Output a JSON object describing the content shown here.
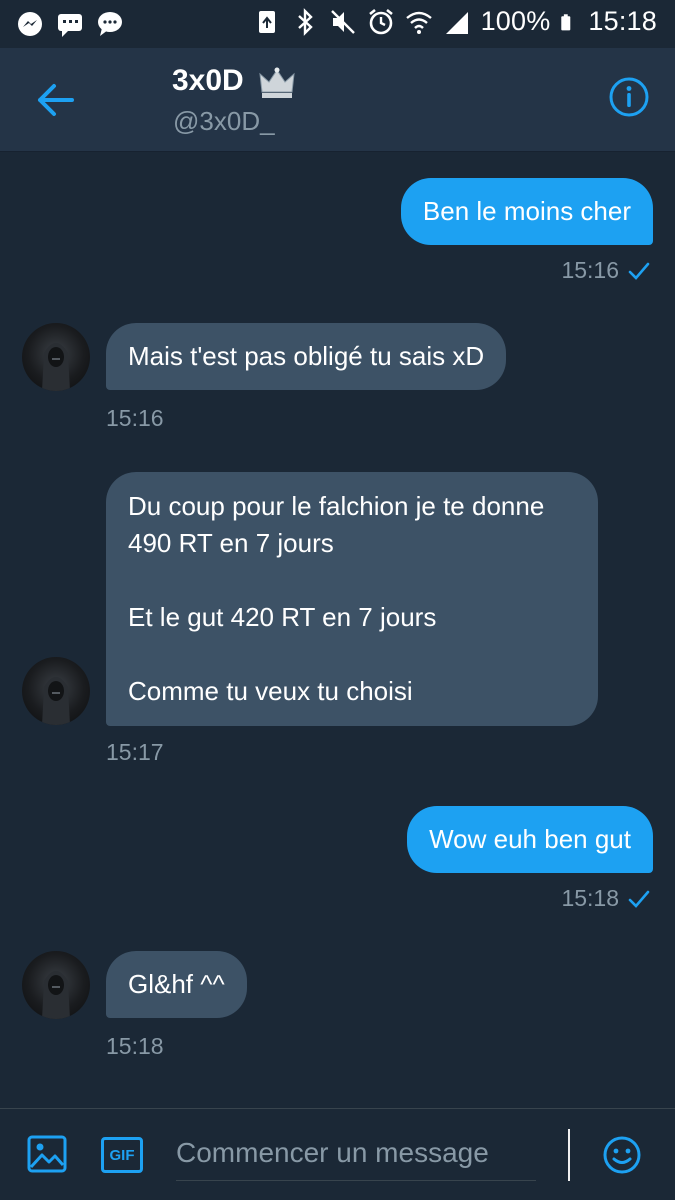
{
  "status_bar": {
    "battery": "100%",
    "time": "15:18",
    "left_icons": [
      "messenger-icon",
      "chat-icon",
      "chat-bubble-icon"
    ],
    "right_icons": [
      "recycle-icon",
      "bluetooth-icon",
      "mute-icon",
      "alarm-icon",
      "wifi-icon",
      "signal-icon",
      "battery-icon"
    ]
  },
  "header": {
    "name": "3x0D",
    "handle": "@3x0D_",
    "back_icon": "arrow-left-icon",
    "info_icon": "info-icon",
    "accent": "#1da1f2"
  },
  "messages": [
    {
      "dir": "out",
      "lines": [
        "Ben le moins cher"
      ],
      "time": "15:16",
      "read": true
    },
    {
      "dir": "in",
      "lines": [
        "Mais t'est pas obligé tu sais xD"
      ],
      "time": "15:16"
    },
    {
      "dir": "in",
      "lines": [
        "Du coup pour le falchion je te donne",
        "490 RT en 7 jours",
        "",
        "Et le gut  420 RT en 7 jours",
        "",
        "Comme tu veux tu choisi"
      ],
      "time": "15:17"
    },
    {
      "dir": "out",
      "lines": [
        "Wow euh ben gut"
      ],
      "time": "15:18",
      "read": true
    },
    {
      "dir": "in",
      "lines": [
        "Gl&hf ^^"
      ],
      "time": "15:18"
    }
  ],
  "composer": {
    "placeholder": "Commencer un message",
    "gif_label": "GIF"
  },
  "colors": {
    "background": "#1b2836",
    "header": "#243447",
    "outgoing_bubble": "#1da1f2",
    "incoming_bubble": "#3d5266",
    "secondary_text": "#8899a6"
  }
}
